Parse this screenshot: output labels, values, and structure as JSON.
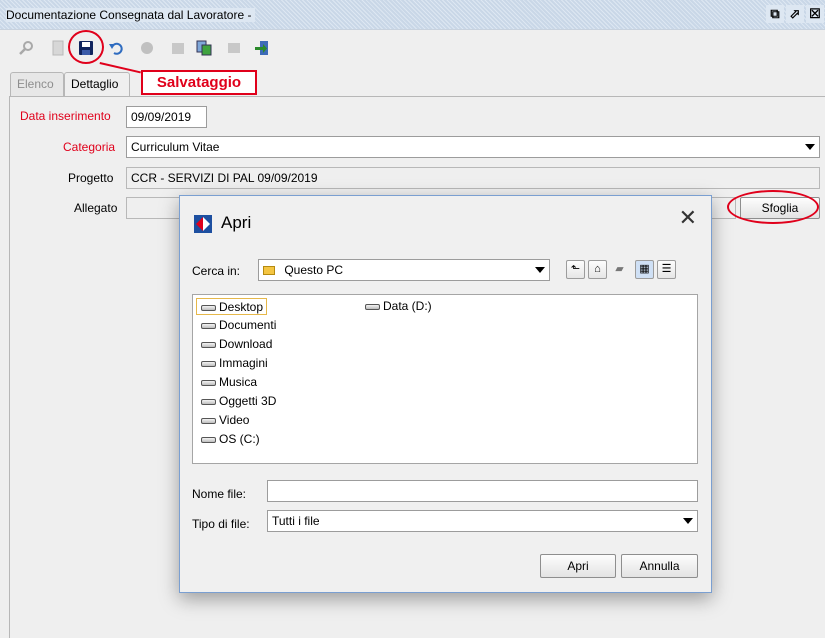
{
  "window": {
    "title": "Documentazione Consegnata dal Lavoratore -",
    "controls": [
      "restore-icon",
      "maximize-icon",
      "close-icon"
    ]
  },
  "toolbar": {
    "icons": [
      "search-icon",
      "new-document-icon",
      "save-icon",
      "undo-icon",
      "delete-icon",
      "print-icon",
      "copy-icon",
      "export-icon",
      "exit-icon"
    ]
  },
  "annotation": {
    "callout_label": "Salvataggio",
    "color": "#e0001b"
  },
  "tabs": [
    {
      "label": "Elenco",
      "active": false
    },
    {
      "label": "Dettaglio",
      "active": true
    }
  ],
  "form": {
    "data_inserimento": {
      "label": "Data inserimento",
      "value": "09/09/2019"
    },
    "categoria": {
      "label": "Categoria",
      "value": "Curriculum Vitae"
    },
    "progetto": {
      "label": "Progetto",
      "value": "CCR - SERVIZI DI PAL 09/09/2019"
    },
    "allegato": {
      "label": "Allegato",
      "value": "",
      "browse_label": "Sfoglia"
    }
  },
  "dialog": {
    "title": "Apri",
    "look_in_label": "Cerca in:",
    "look_in_value": "Questo PC",
    "items": [
      "Desktop",
      "Documenti",
      "Download",
      "Immagini",
      "Musica",
      "Oggetti 3D",
      "Video",
      "OS (C:)",
      "Data (D:)"
    ],
    "selected_item": "Desktop",
    "filename_label": "Nome file:",
    "filename_value": "",
    "filetype_label": "Tipo di file:",
    "filetype_value": "Tutti i file",
    "open_label": "Apri",
    "cancel_label": "Annulla"
  }
}
